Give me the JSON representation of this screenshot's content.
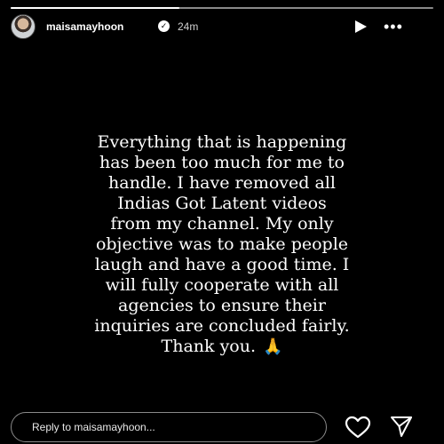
{
  "story": {
    "progress": 0.4,
    "header": {
      "username": "maisamayhoon",
      "time": "24m",
      "verified_icon": "verified-check-icon",
      "play_icon": "play-icon",
      "more_icon": "more-dots-icon"
    },
    "message": {
      "text": "Everything that is happening\nhas been too much for me to\nhandle. I have removed all\nIndias Got Latent videos\nfrom my channel. My only\nobjective was to make people\nlaugh and have a good time. I\nwill fully cooperate with all\nagencies to ensure their\ninquiries are concluded fairly.\nThank you.",
      "emoji": "🙏"
    },
    "footer": {
      "reply_placeholder": "Reply to maisamayhoon...",
      "heart_icon": "heart-icon",
      "send_icon": "send-icon"
    },
    "colors": {
      "background": "#000000",
      "text": "#ffffff",
      "emoji": "#f5b820"
    }
  }
}
